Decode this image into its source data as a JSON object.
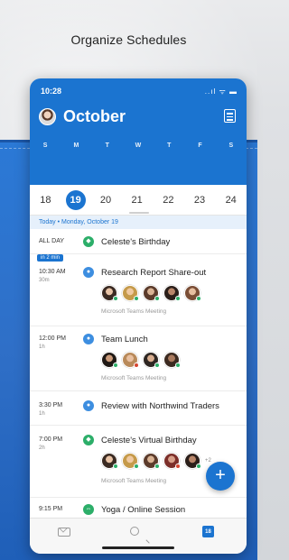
{
  "headline": "Organize Schedules",
  "status": {
    "time": "10:28",
    "icons": "..ıl ᯤ ▬"
  },
  "header": {
    "month": "October",
    "weekdays": [
      "S",
      "M",
      "T",
      "W",
      "T",
      "F",
      "S"
    ],
    "dates": [
      "18",
      "19",
      "20",
      "21",
      "22",
      "23",
      "24"
    ],
    "selected_date": "19"
  },
  "today_label": "Today • Monday, October 19",
  "now_badge": "in 2 min",
  "events": [
    {
      "time": "ALL DAY",
      "duration": "",
      "title": "Celeste's Birthday",
      "icon": "birthday-icon"
    },
    {
      "time": "10:30 AM",
      "duration": "30m",
      "title": "Research Report Share-out",
      "location": "Microsoft Teams Meeting",
      "icon": "teams-icon"
    },
    {
      "time": "12:00 PM",
      "duration": "1h",
      "title": "Team Lunch",
      "location": "Microsoft Teams Meeting",
      "icon": "teams-icon"
    },
    {
      "time": "3:30 PM",
      "duration": "1h",
      "title": "Review with Northwind Traders",
      "icon": "teams-icon"
    },
    {
      "time": "7:00 PM",
      "duration": "2h",
      "title": "Celeste's Virtual Birthday",
      "location": "Microsoft Teams Meeting",
      "extra": "+2",
      "icon": "birthday-icon"
    },
    {
      "time": "9:15 PM",
      "duration": "",
      "title": "Yoga / Online Session",
      "icon": "activity-icon"
    }
  ],
  "colors": {
    "accent": "#1b74d0",
    "green": "#2cae69",
    "teams": "#3d8ee0"
  },
  "calendar_tab_date": "18",
  "fab_label": "+"
}
